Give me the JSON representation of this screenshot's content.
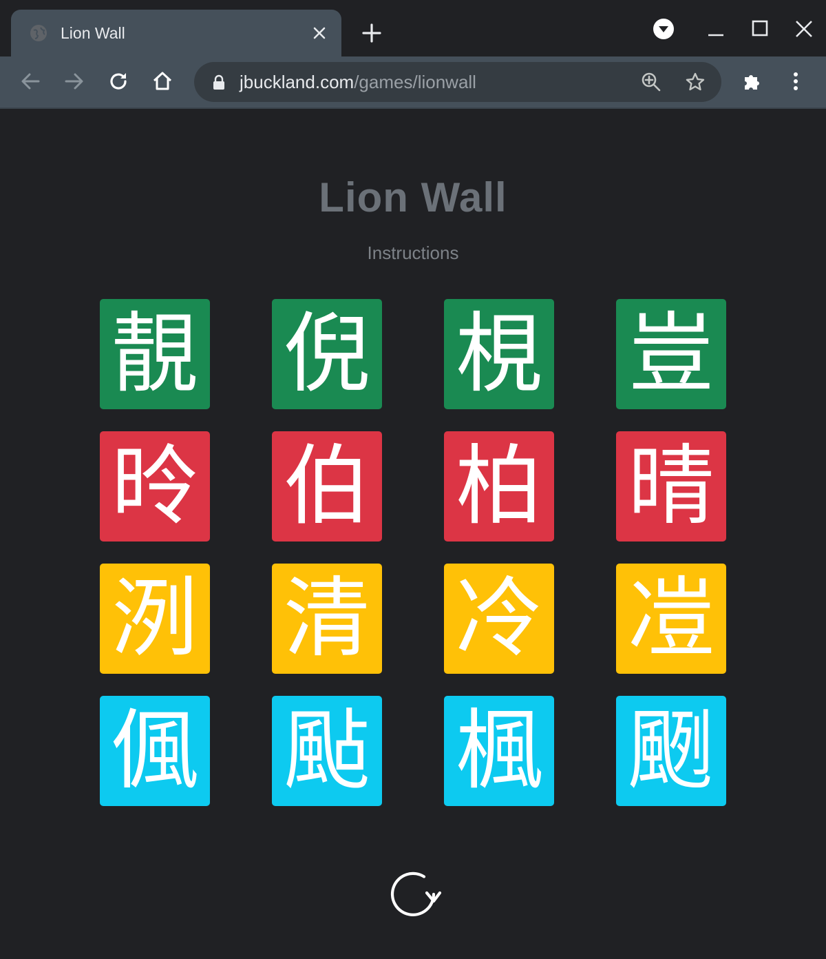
{
  "browser": {
    "tab": {
      "title": "Lion Wall",
      "favicon": "globe-icon",
      "close_icon": "close-icon"
    },
    "new_tab_icon": "plus-icon",
    "window_controls": [
      "profile-dropdown-icon",
      "minimize-icon",
      "maximize-icon",
      "close-window-icon"
    ],
    "toolbar": {
      "back_icon": "back-arrow-icon",
      "forward_icon": "forward-arrow-icon",
      "reload_icon": "reload-icon",
      "home_icon": "home-icon",
      "extensions_icon": "puzzle-icon",
      "menu_icon": "kebab-menu-icon"
    },
    "omnibox": {
      "host": "jbuckland.com",
      "path": "/games/lionwall",
      "lock_icon": "lock-icon",
      "zoom_icon": "zoom-icon",
      "bookmark_icon": "star-icon"
    }
  },
  "page": {
    "title": "Lion Wall",
    "instructions_link": "Instructions",
    "reset_icon": "reset-icon"
  },
  "wall": {
    "groups": [
      {
        "color": "#1a8a52",
        "chars": [
          "靚",
          "倪",
          "梘",
          "豈"
        ]
      },
      {
        "color": "#dc3545",
        "chars": [
          "昤",
          "伯",
          "柏",
          "晴"
        ]
      },
      {
        "color": "#ffc107",
        "chars": [
          "洌",
          "清",
          "冷",
          "凒"
        ]
      },
      {
        "color": "#0dcaf0",
        "chars": [
          "偑",
          "颭",
          "楓",
          "颲"
        ]
      }
    ]
  },
  "colors": {
    "background": "#202124",
    "chrome": "#45505a",
    "title": "#6b7178",
    "muted_text": "#7d8288"
  }
}
